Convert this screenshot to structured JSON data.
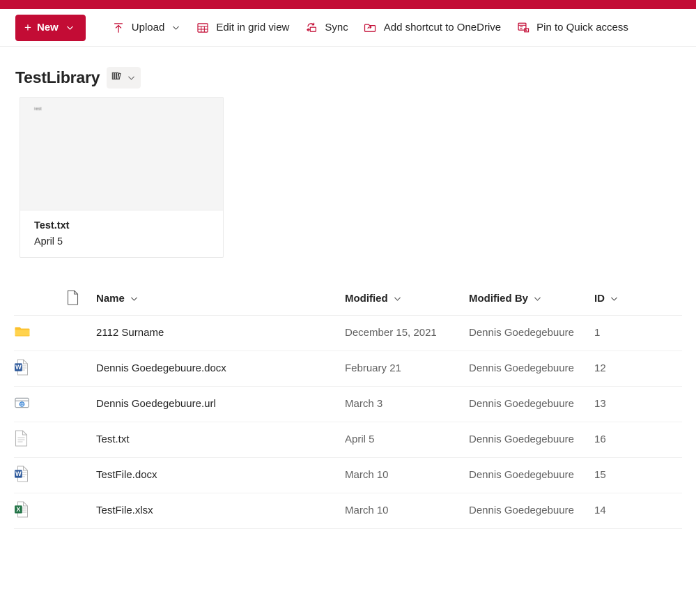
{
  "theme": {
    "accent": "#c30c35",
    "text": "#242424",
    "muted": "#616161"
  },
  "command_bar": {
    "new_button": {
      "label": "New",
      "plus_icon": "plus-icon",
      "chevron_icon": "chevron-down-icon"
    },
    "items": [
      {
        "label": "Upload",
        "icon": "upload-icon",
        "has_chevron": true
      },
      {
        "label": "Edit in grid view",
        "icon": "grid-view-icon",
        "has_chevron": false
      },
      {
        "label": "Sync",
        "icon": "sync-icon",
        "has_chevron": false
      },
      {
        "label": "Add shortcut to OneDrive",
        "icon": "onedrive-shortcut-icon",
        "has_chevron": false
      },
      {
        "label": "Pin to Quick access",
        "icon": "pin-quick-access-icon",
        "has_chevron": false
      }
    ]
  },
  "library": {
    "title": "TestLibrary",
    "view_switcher": {
      "icon": "library-books-icon",
      "chevron_icon": "chevron-down-icon"
    }
  },
  "tiles": [
    {
      "preview_text": "Test",
      "name": "Test.txt",
      "date": "April 5",
      "icon": "text-file-icon"
    }
  ],
  "list": {
    "columns": [
      {
        "key": "icon",
        "label": "",
        "icon": "document-icon",
        "has_chevron": false
      },
      {
        "key": "name",
        "label": "Name",
        "has_chevron": true
      },
      {
        "key": "modified",
        "label": "Modified",
        "has_chevron": true
      },
      {
        "key": "modified_by",
        "label": "Modified By",
        "has_chevron": true
      },
      {
        "key": "id",
        "label": "ID",
        "has_chevron": true
      }
    ],
    "rows": [
      {
        "icon": "folder-icon",
        "name": "2112 Surname",
        "modified": "December 15, 2021",
        "modified_by": "Dennis Goedegebuure",
        "id": "1"
      },
      {
        "icon": "word-icon",
        "name": "Dennis Goedegebuure.docx",
        "modified": "February 21",
        "modified_by": "Dennis Goedegebuure",
        "id": "12"
      },
      {
        "icon": "url-icon",
        "name": "Dennis Goedegebuure.url",
        "modified": "March 3",
        "modified_by": "Dennis Goedegebuure",
        "id": "13"
      },
      {
        "icon": "text-file-icon",
        "name": "Test.txt",
        "modified": "April 5",
        "modified_by": "Dennis Goedegebuure",
        "id": "16"
      },
      {
        "icon": "word-icon",
        "name": "TestFile.docx",
        "modified": "March 10",
        "modified_by": "Dennis Goedegebuure",
        "id": "15"
      },
      {
        "icon": "excel-icon",
        "name": "TestFile.xlsx",
        "modified": "March 10",
        "modified_by": "Dennis Goedegebuure",
        "id": "14"
      }
    ]
  }
}
